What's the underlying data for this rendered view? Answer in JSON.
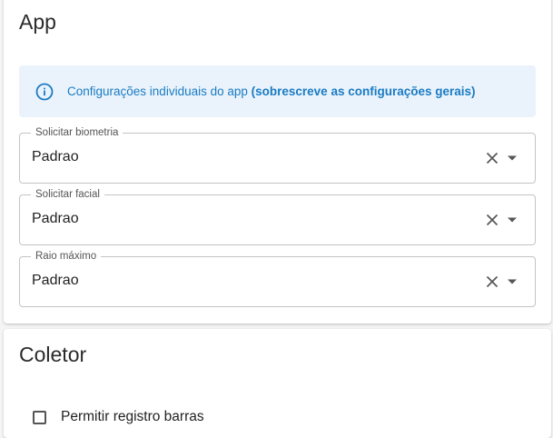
{
  "app_section": {
    "title": "App",
    "info": {
      "icon": "info-icon",
      "text": "Configurações individuais do app ",
      "bold_text": "(sobrescreve as configurações gerais)",
      "color": "#1a7bc4",
      "background": "#eaf3fb"
    },
    "fields": [
      {
        "label": "Solicitar biometria",
        "value": "Padrao"
      },
      {
        "label": "Solicitar facial",
        "value": "Padrao"
      },
      {
        "label": "Raio máximo",
        "value": "Padrao"
      }
    ]
  },
  "coletor_section": {
    "title": "Coletor",
    "checkbox_label": "Permitir registro barras",
    "checkbox_checked": false
  }
}
